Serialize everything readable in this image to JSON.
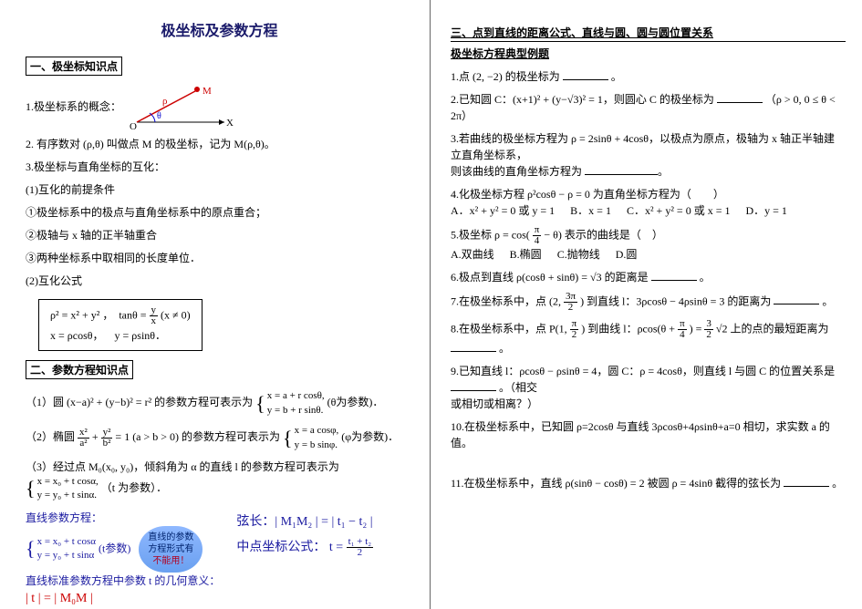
{
  "title": "极坐标及参数方程",
  "left": {
    "sec1": "一、极坐标知识点",
    "p1": "1.极坐标系的概念：",
    "diagramLabels": {
      "M": "M",
      "O": "O",
      "rho": "ρ",
      "theta": "θ",
      "X": "X"
    },
    "p2": "2. 有序数对 (ρ,θ) 叫做点 M 的极坐标，记为 M(ρ,θ)。",
    "p3": "3.极坐标与直角坐标的互化：",
    "c1": "(1)互化的前提条件",
    "c1a": "①极坐标系中的极点与直角坐标系中的原点重合；",
    "c1b": "②极轴与 x 轴的正半轴重合",
    "c1c": "③两种坐标系中取相同的长度单位．",
    "c2": "(2)互化公式",
    "fbox1": "ρ² = x² + y² ，　tanθ = ",
    "fbox1b": "(x ≠ 0)",
    "fbox2a": "x = ρcosθ，",
    "fbox2b": "y = ρsinθ．",
    "sec2": "二、参数方程知识点",
    "pm1a": "（1）圆 (x−a)² + (y−b)² = r² 的参数方程可表示为",
    "pm1eq1": "x = a + r cosθ,",
    "pm1eq2": "y = b + r sinθ.",
    "pm1tail": "(θ为参数)．",
    "pm2a": "（2）椭圆 ",
    "pm2mid": " = 1 (a > b > 0) 的参数方程可表示为",
    "pm2eq1": "x = a cosφ,",
    "pm2eq2": "y = b sinφ.",
    "pm2tail": "(φ为参数)．",
    "pm3a": "（3）经过点 M₀(x₀, y₀)，倾斜角为 α 的直线 l 的参数方程可表示为",
    "pm3eq1": "x = x₀ + t cosα,",
    "pm3eq2": "y = y₀ + t sinα.",
    "pm3tail": "（t 为参数）．",
    "ps_head": "直线参数方程：",
    "ps_eq1": "x = x₀ + t cosα",
    "ps_eq2": "y = y₀ + t sinα",
    "ps_note": "(t参数)",
    "bubble1": "直线的参数",
    "bubble2": "方程形式有",
    "bubble3": "不能用！",
    "ps_std": "直线标准参数方程中参数 t 的几何意义：",
    "ps_t": "| t | = | M₀M |",
    "rs1": "弦长：| M₁M₂ | = | t₁ − t₂ |",
    "rs2a": "中点坐标公式：",
    "rs2b": "t = "
  },
  "right": {
    "sec3": "三、点到直线的距离公式、直线与圆、圆与圆位置关系",
    "sub": "极坐标方程典型例题",
    "q1a": "1.点 (2, −2) 的极坐标为",
    "q1b": "。",
    "q2a": "2.已知圆 C：(x+1)² + (y−√3)² = 1，则圆心 C 的极坐标为",
    "q2b": "（ρ > 0, 0 ≤ θ < 2π）",
    "q3a": "3.若曲线的极坐标方程为 ρ = 2sinθ + 4cosθ，以极点为原点，极轴为 x 轴正半轴建立直角坐标系，",
    "q3b": "则该曲线的直角坐标方程为",
    "q4": "4.化极坐标方程 ρ²cosθ − ρ = 0 为直角坐标方程为（　　）",
    "q4A": "A．x² + y² = 0 或 y = 1",
    "q4B": "B．x = 1",
    "q4C": "C．x² + y² = 0 或 x = 1",
    "q4D": "D．y = 1",
    "q5a": "5.极坐标 ρ = cos(",
    "q5mid": " − θ) 表示的曲线是（　）",
    "q5A": "A.双曲线",
    "q5B": "B.椭圆",
    "q5C": "C.抛物线",
    "q5D": "D.圆",
    "q6a": "6.极点到直线 ρ(cosθ + sinθ) = √3 的距离是",
    "q6b": "。",
    "q7a": "7.在极坐标系中，点 (2, ",
    "q7b": ") 到直线 l：3ρcosθ − 4ρsinθ = 3 的距离为",
    "q7c": "。",
    "q8a": "8.在极坐标系中，点 P(1, ",
    "q8b": ") 到曲线 l：ρcos(θ + ",
    "q8c": ") = ",
    "q8d": "√2 上的点的最短距离为",
    "q8e": "。",
    "q9a": "9.已知直线 l：ρcosθ − ρsinθ = 4，圆 C：ρ = 4cosθ，则直线 l 与圆 C 的位置关系是",
    "q9b": "。（相交",
    "q9c": "或相切或相离？）",
    "q10a": "10.在极坐标系中，已知圆 ρ=2cosθ 与直线 3ρcosθ+4ρsinθ+a=0 相切，求实数 a 的值。",
    "q11a": "11.在极坐标系中，直线 ρ(sinθ − cosθ) = 2 被圆 ρ = 4sinθ 截得的弦长为",
    "q11b": "。"
  }
}
